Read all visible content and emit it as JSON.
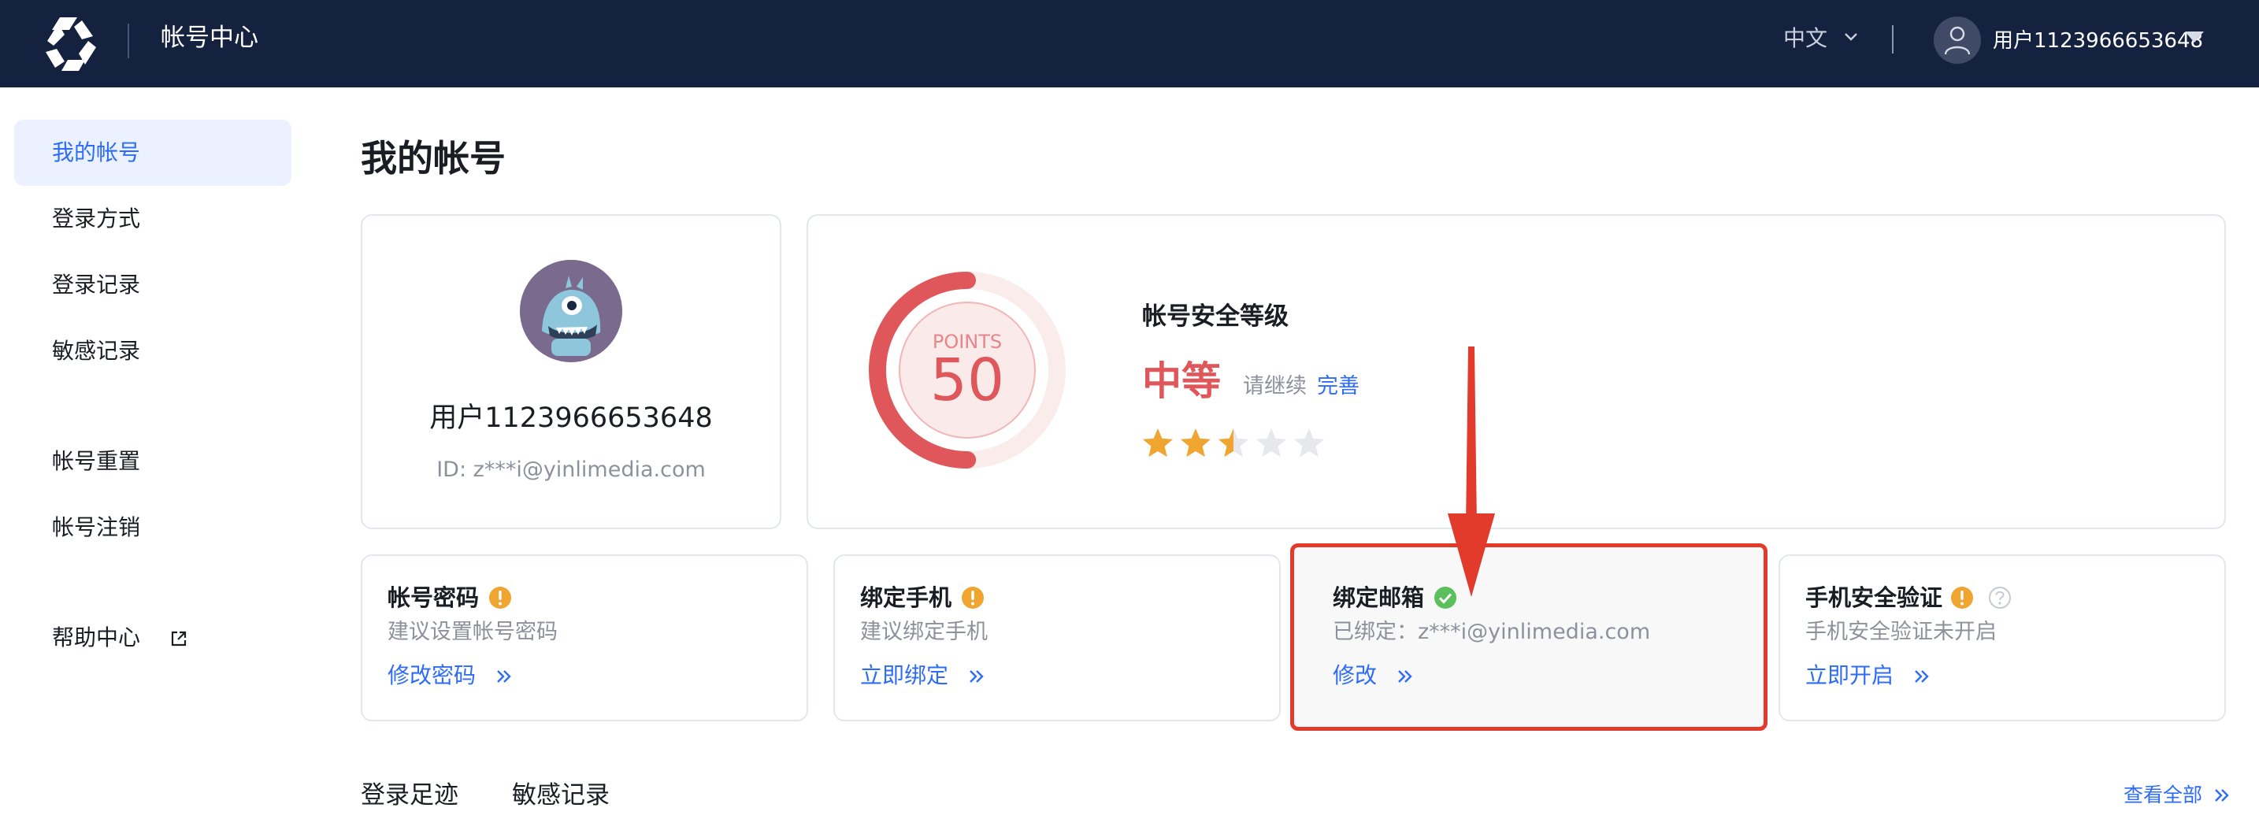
{
  "header": {
    "app_title": "帐号中心",
    "language": "中文",
    "username": "用户1123966653648"
  },
  "sidebar": {
    "items": [
      {
        "label": "我的帐号",
        "active": true
      },
      {
        "label": "登录方式"
      },
      {
        "label": "登录记录"
      },
      {
        "label": "敏感记录"
      },
      {
        "label": "帐号重置"
      },
      {
        "label": "帐号注销"
      },
      {
        "label": "帮助中心",
        "external": true
      }
    ]
  },
  "main": {
    "title": "我的帐号",
    "profile": {
      "name": "用户1123966653648",
      "id_text": "ID: z***i@yinlimedia.com"
    },
    "security": {
      "points_label": "POINTS",
      "points": "50",
      "points_value": 50,
      "title": "帐号安全等级",
      "level": "中等",
      "hint": "请继续",
      "improve_link": "完善",
      "stars": 2.5,
      "stars_max": 5
    },
    "settings": [
      {
        "title": "帐号密码",
        "status": "warning",
        "desc": "建议设置帐号密码",
        "action": "修改密码"
      },
      {
        "title": "绑定手机",
        "status": "warning",
        "desc": "建议绑定手机",
        "action": "立即绑定"
      },
      {
        "title": "绑定邮箱",
        "status": "ok",
        "desc": "已绑定：z***i@yinlimedia.com",
        "action": "修改"
      },
      {
        "title": "手机安全验证",
        "status": "warning",
        "desc": "手机安全验证未开启",
        "action": "立即开启"
      }
    ],
    "tabs": [
      "登录足迹",
      "敏感记录"
    ],
    "view_all": "查看全部"
  },
  "colors": {
    "topbar": "#14213f",
    "accent": "#2e6cf6",
    "danger": "#e0575b",
    "warning": "#f0a531",
    "ok": "#5bbf5b",
    "annotation": "#e23a2b"
  },
  "icons": [
    "logo-icon",
    "chevron-down-icon",
    "user-icon",
    "caret-down-icon",
    "external-link-icon",
    "warning-icon",
    "check-circle-icon",
    "help-circle-icon",
    "double-chevron-right-icon",
    "star-icon"
  ]
}
